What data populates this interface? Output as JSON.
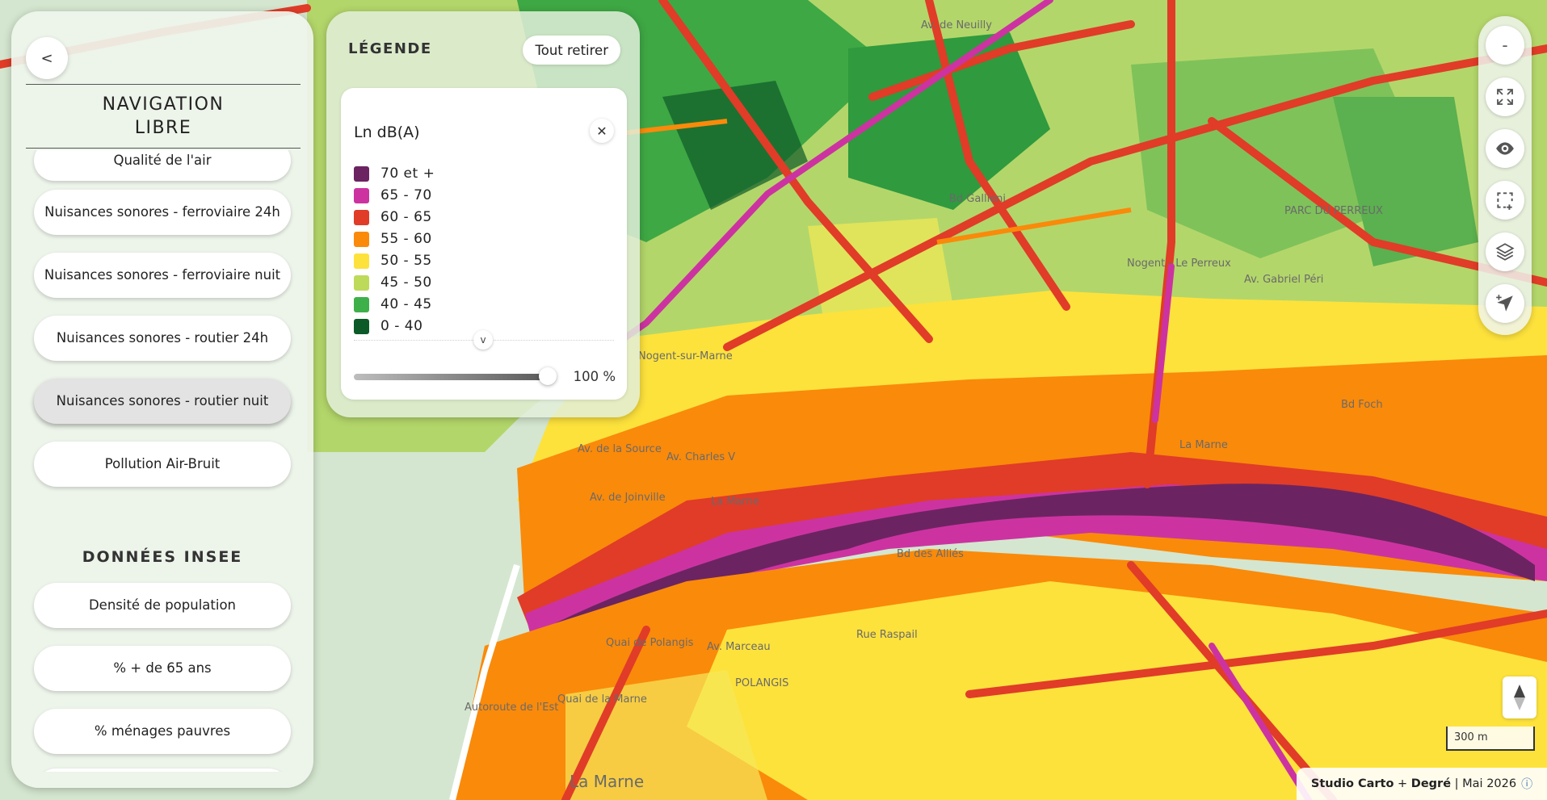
{
  "nav": {
    "back_label": "<",
    "title_line1": "NAVIGATION",
    "title_line2": "LIBRE",
    "items": [
      {
        "label": "Qualité de l'air"
      },
      {
        "label": "Nuisances sonores - ferroviaire 24h"
      },
      {
        "label": "Nuisances sonores - ferroviaire nuit"
      },
      {
        "label": "Nuisances sonores - routier 24h"
      },
      {
        "label": "Nuisances sonores - routier nuit",
        "active": true
      },
      {
        "label": "Pollution Air-Bruit"
      }
    ],
    "section_insee": "DONNÉES INSEE",
    "insee_items": [
      {
        "label": "Densité de population"
      },
      {
        "label": "% + de 65 ans"
      },
      {
        "label": "% ménages pauvres"
      }
    ]
  },
  "legend": {
    "title": "LÉGENDE",
    "clear_label": "Tout retirer",
    "layer_title": "Ln dB(A)",
    "close_label": "✕",
    "expand_label": "v",
    "items": [
      {
        "label": "70 et +",
        "color": "#6b2461"
      },
      {
        "label": "65 - 70",
        "color": "#cc33a1"
      },
      {
        "label": "60 - 65",
        "color": "#e03c28"
      },
      {
        "label": "55 - 60",
        "color": "#fa8a0a"
      },
      {
        "label": "50 - 55",
        "color": "#fde23c"
      },
      {
        "label": "45 - 50",
        "color": "#bdda5a"
      },
      {
        "label": "40 - 45",
        "color": "#3eb04a"
      },
      {
        "label": "0 - 40",
        "color": "#0b5a28"
      }
    ],
    "opacity_value": "100 %",
    "opacity_fraction": 1.0
  },
  "toolbar": {
    "zoom_out": "-",
    "buttons": [
      "fullscreen-icon",
      "eye-icon",
      "select-area-icon",
      "layers-icon",
      "locate-icon"
    ]
  },
  "map": {
    "labels": [
      "Av. de Neuilly",
      "Nogent - Le Perreux",
      "Nogent-sur-Marne",
      "PARC DU PERREUX",
      "Av. Gabriel Péri",
      "La Marne",
      "La Marne",
      "Bd des Alliés",
      "Bd Foch",
      "Av. Marceau",
      "POLANGIS",
      "Rue Raspail",
      "Autoroute de l'Est",
      "Quai de la Marne",
      "Quai de Polangis",
      "Av. de Joinville",
      "Av. Charles V",
      "Av. de la Source",
      "Bd Gallieni",
      "La Marne"
    ]
  },
  "scale": {
    "label": "300 m"
  },
  "attribution": {
    "studio": "Studio Carto",
    "plus": "+",
    "partner": "Degré",
    "sep": "|",
    "date": "Mai 2026",
    "info": "ⓘ"
  }
}
